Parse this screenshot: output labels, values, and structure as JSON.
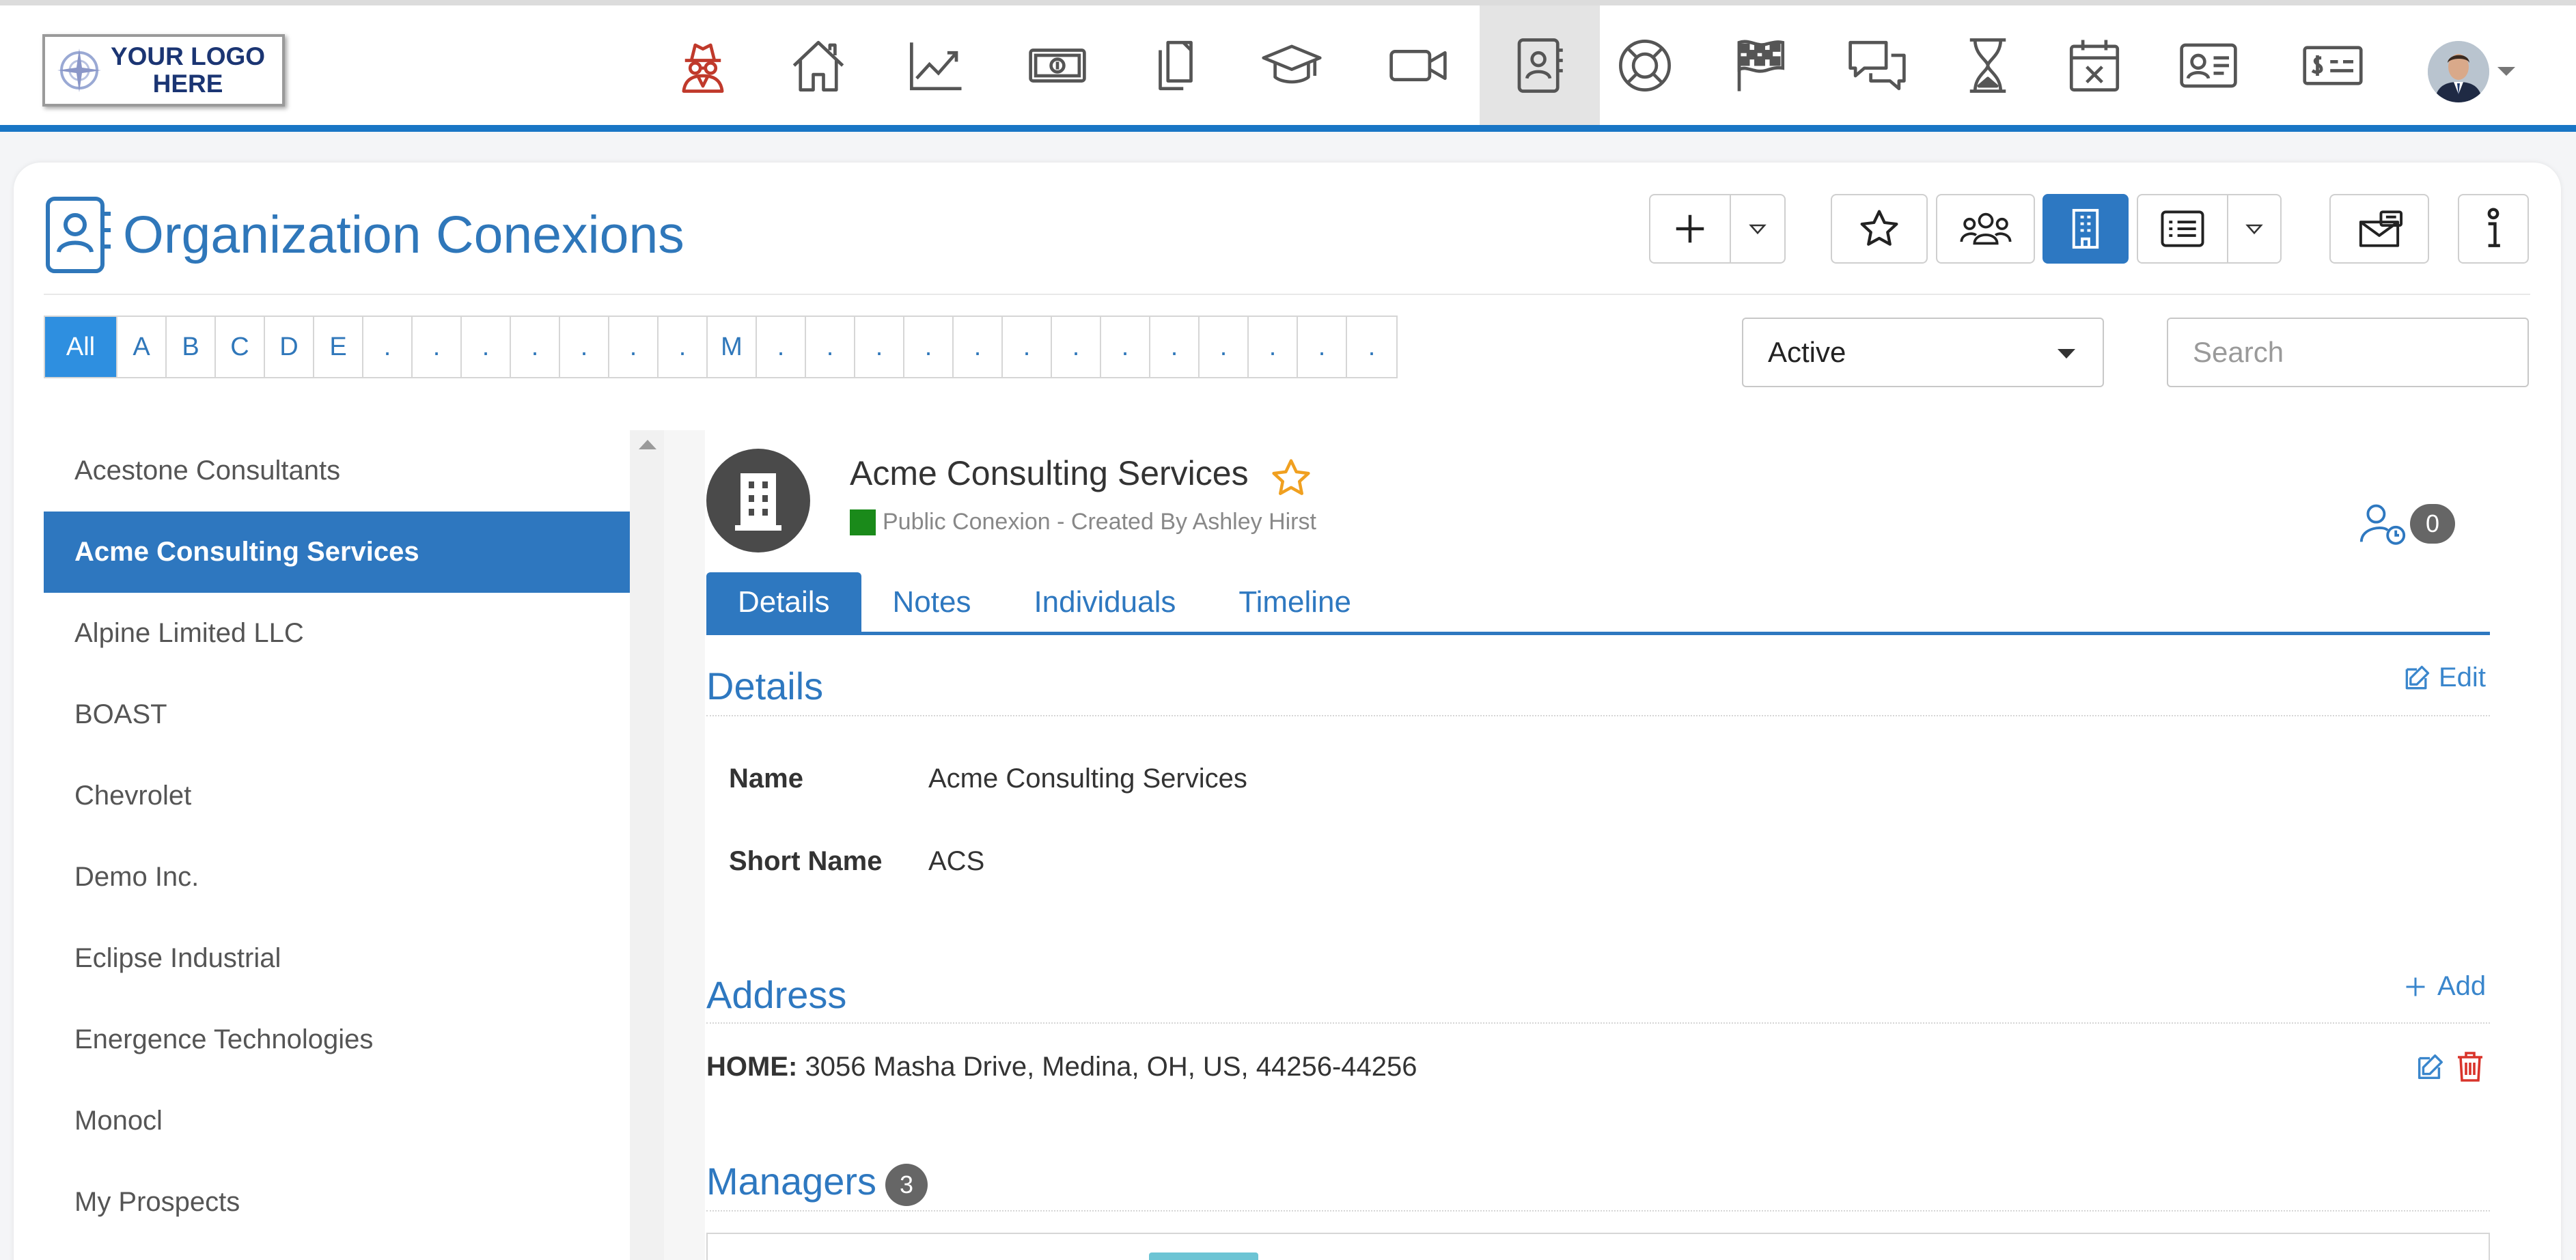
{
  "logo": {
    "text": "YOUR LOGO HERE"
  },
  "nav": {
    "icons": [
      "spy-icon",
      "home-icon",
      "chart-line-icon",
      "money-icon",
      "documents-icon",
      "graduation-cap-icon",
      "video-camera-icon",
      "contacts-book-icon",
      "lifebuoy-icon",
      "checkered-flag-icon",
      "chat-bubbles-icon",
      "hourglass-icon",
      "calendar-x-icon",
      "id-card-icon",
      "bill-icon"
    ],
    "active": "contacts-book-icon",
    "accent": "#1976c5"
  },
  "page": {
    "title": "Organization Conexions"
  },
  "alphabet": [
    "All",
    "A",
    "B",
    "C",
    "D",
    "E",
    ".",
    ".",
    ".",
    ".",
    ".",
    ".",
    ".",
    "M",
    ".",
    ".",
    ".",
    ".",
    ".",
    ".",
    ".",
    ".",
    ".",
    ".",
    ".",
    ".",
    "."
  ],
  "filter": {
    "status": "Active",
    "search_placeholder": "Search"
  },
  "organizations": [
    "Acestone Consultants",
    "Acme Consulting Services",
    "Alpine Limited LLC",
    "BOAST",
    "Chevrolet",
    "Demo Inc.",
    "Eclipse Industrial",
    "Energence Technologies",
    "Monocl",
    "My Prospects"
  ],
  "selected_org": "Acme Consulting Services",
  "detail": {
    "name": "Acme Consulting Services",
    "subtitle": "Public Conexion - Created By Ashley Hirst",
    "status_color": "#1a8a1a",
    "watchers": "0",
    "tabs": [
      "Details",
      "Notes",
      "Individuals",
      "Timeline"
    ],
    "active_tab": "Details",
    "details_title": "Details",
    "edit_label": "Edit",
    "fields": [
      {
        "label": "Name",
        "value": "Acme Consulting Services"
      },
      {
        "label": "Short Name",
        "value": "ACS"
      }
    ],
    "address_title": "Address",
    "add_label": "Add",
    "address_type": "HOME:",
    "address_value": "3056 Masha Drive, Medina, OH, US, 44256-44256",
    "managers_title": "Managers",
    "managers_count": "3"
  }
}
